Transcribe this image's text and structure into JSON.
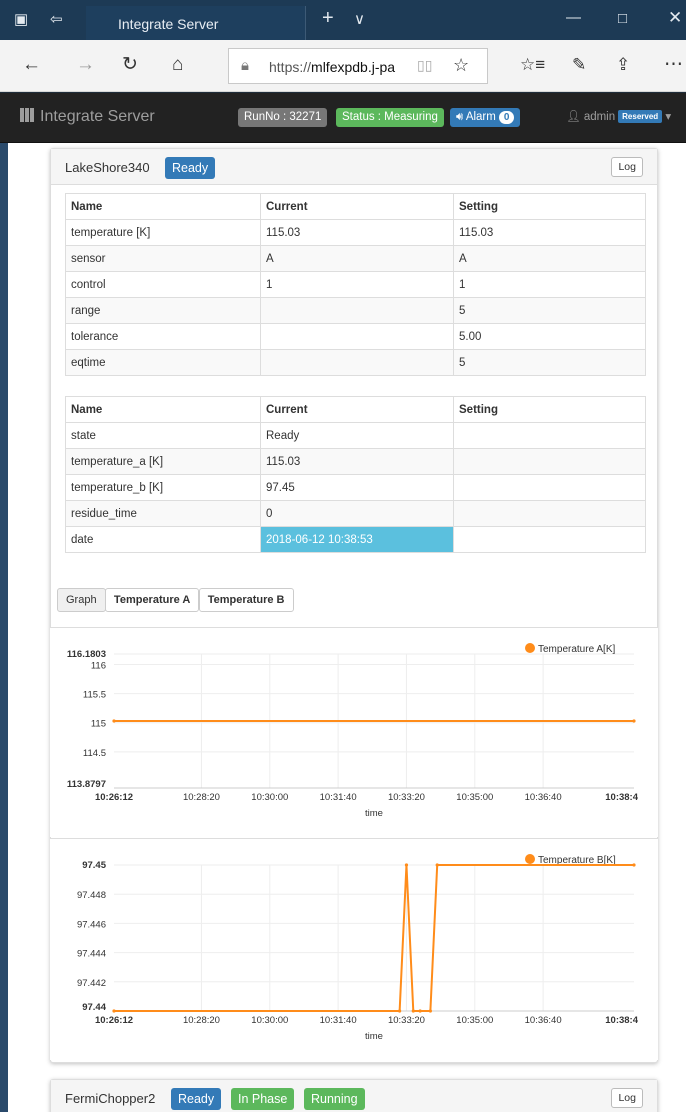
{
  "browser": {
    "tab_title": "Integrate Server",
    "url_prefix": "https://",
    "url_host": "mlfexpdb.j-pa"
  },
  "navbar": {
    "brand": "Integrate Server",
    "run_no": "RunNo : 32271",
    "status": "Status : Measuring",
    "alarm": "Alarm",
    "alarm_count": "0",
    "user": "admin",
    "reserved": "Reserved"
  },
  "lakeshore": {
    "title": "LakeShore340",
    "badge": "Ready",
    "log": "Log",
    "table1": {
      "headers": [
        "Name",
        "Current",
        "Setting"
      ],
      "rows": [
        [
          "temperature [K]",
          "115.03",
          "115.03"
        ],
        [
          "sensor",
          "A",
          "A"
        ],
        [
          "control",
          "1",
          "1"
        ],
        [
          "range",
          "",
          "5"
        ],
        [
          "tolerance",
          "",
          "5.00"
        ],
        [
          "eqtime",
          "",
          "5"
        ]
      ]
    },
    "table2": {
      "headers": [
        "Name",
        "Current",
        "Setting"
      ],
      "rows": [
        [
          "state",
          "Ready",
          ""
        ],
        [
          "temperature_a [K]",
          "115.03",
          ""
        ],
        [
          "temperature_b [K]",
          "97.45",
          ""
        ],
        [
          "residue_time",
          "0",
          ""
        ],
        [
          "date",
          "2018-06-12 10:38:53",
          ""
        ]
      ]
    },
    "graph_tabs": [
      "Graph",
      "Temperature A",
      "Temperature B"
    ]
  },
  "fermichopper": {
    "title": "FermiChopper2",
    "badges": [
      "Ready",
      "In Phase",
      "Running"
    ],
    "log": "Log"
  },
  "colors": {
    "series": "#ff8c1a",
    "ready": "#337ab7",
    "success": "#5cb85c",
    "info": "#5bc0de"
  },
  "chart_data": [
    {
      "type": "line",
      "legend": "Temperature A[K]",
      "legend_position": "top-right",
      "xlabel": "time",
      "x_ticks": [
        "10:26:12",
        "10:28:20",
        "10:30:00",
        "10:31:40",
        "10:33:20",
        "10:35:00",
        "10:36:40",
        "10:38:4"
      ],
      "y_ticks": [
        "116.1803",
        "116",
        "115.5",
        "115",
        "114.5",
        "113.8797"
      ],
      "ylim": [
        113.8797,
        116.1803
      ],
      "series": [
        {
          "name": "Temperature A[K]",
          "x": [
            "10:26:12",
            "10:38:53"
          ],
          "y": [
            115.03,
            115.03
          ]
        }
      ]
    },
    {
      "type": "line",
      "legend": "Temperature B[K]",
      "legend_position": "top-right",
      "xlabel": "time",
      "x_ticks": [
        "10:26:12",
        "10:28:20",
        "10:30:00",
        "10:31:40",
        "10:33:20",
        "10:35:00",
        "10:36:40",
        "10:38:4"
      ],
      "y_ticks": [
        "97.45",
        "97.448",
        "97.446",
        "97.444",
        "97.442",
        "97.44"
      ],
      "ylim": [
        97.44,
        97.45
      ],
      "series": [
        {
          "name": "Temperature B[K]",
          "x": [
            "10:26:12",
            "10:33:10",
            "10:33:20",
            "10:33:30",
            "10:33:40",
            "10:33:55",
            "10:34:05",
            "10:38:53"
          ],
          "y": [
            97.44,
            97.44,
            97.45,
            97.44,
            97.44,
            97.44,
            97.45,
            97.45
          ]
        }
      ]
    }
  ]
}
